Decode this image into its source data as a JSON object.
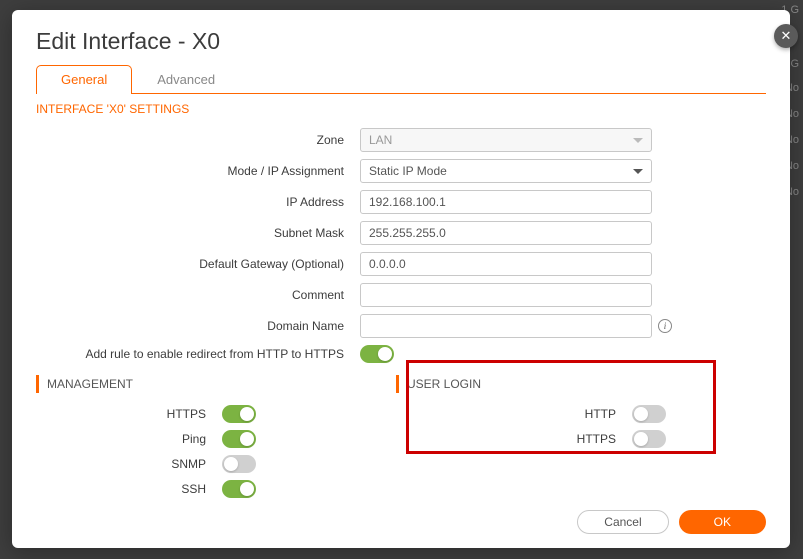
{
  "bg": {
    "col1": "1 G",
    "col2": "No"
  },
  "dialog": {
    "title": "Edit Interface - X0",
    "tabs": {
      "general": "General",
      "advanced": "Advanced"
    },
    "section_title": "INTERFACE 'X0' SETTINGS",
    "fields": {
      "zone_label": "Zone",
      "zone_value": "LAN",
      "mode_label": "Mode / IP Assignment",
      "mode_value": "Static IP Mode",
      "ip_label": "IP Address",
      "ip_value": "192.168.100.1",
      "subnet_label": "Subnet Mask",
      "subnet_value": "255.255.255.0",
      "gateway_label": "Default Gateway (Optional)",
      "gateway_value": "0.0.0.0",
      "comment_label": "Comment",
      "comment_value": "",
      "domain_label": "Domain Name",
      "domain_value": "",
      "redirect_label": "Add rule to enable redirect from HTTP to HTTPS"
    },
    "management": {
      "title": "MANAGEMENT",
      "https_label": "HTTPS",
      "ping_label": "Ping",
      "snmp_label": "SNMP",
      "ssh_label": "SSH"
    },
    "user_login": {
      "title": "USER LOGIN",
      "http_label": "HTTP",
      "https_label": "HTTPS"
    },
    "buttons": {
      "cancel": "Cancel",
      "ok": "OK"
    }
  }
}
